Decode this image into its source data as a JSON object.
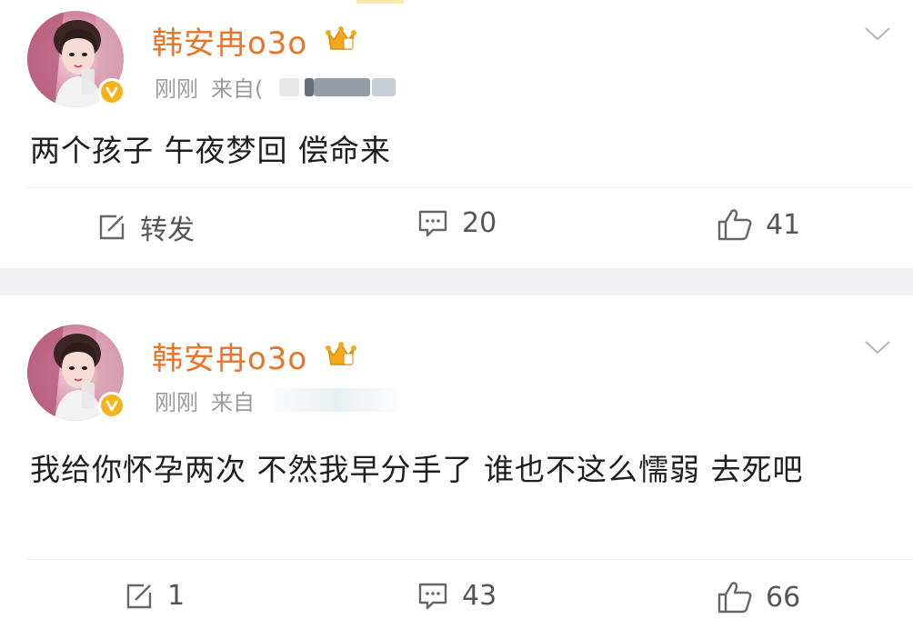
{
  "posts": [
    {
      "username": "韩安冉o3o",
      "time": "刚刚",
      "source_prefix": "来自",
      "source_visible_fragment": "(",
      "text": "两个孩子 午夜梦回 偿命来",
      "actions": {
        "repost": "转发",
        "comments": "20",
        "likes": "41"
      }
    },
    {
      "username": "韩安冉o3o",
      "time": "刚刚",
      "source_prefix": "来自",
      "text": "我给你怀孕两次 不然我早分手了 谁也不这么懦弱 去死吧",
      "actions": {
        "repost": "1",
        "comments": "43",
        "likes": "66"
      }
    }
  ],
  "colors": {
    "username": "#e8752a",
    "meta": "#9b9b9b",
    "separator": "#f1f1f3",
    "verified_badge": "#f5b31d"
  },
  "icons": [
    "chevron-down-icon",
    "repost-icon",
    "comment-icon",
    "like-icon",
    "crown-badge-icon",
    "verified-badge-icon"
  ]
}
